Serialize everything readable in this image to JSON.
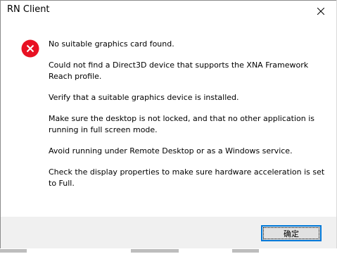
{
  "window": {
    "title": "RN Client",
    "close_icon": "close-icon"
  },
  "message": {
    "icon": "error-icon",
    "icon_color": "#e81123",
    "lines": [
      "No suitable graphics card found.",
      "Could not find a Direct3D device that supports the XNA Framework Reach profile.",
      "Verify that a suitable graphics device is installed.",
      "Make sure the desktop is not locked, and that no other application is running in full screen mode.",
      "Avoid running under Remote Desktop or as a Windows service.",
      "Check the display properties to make sure hardware acceleration is set to Full."
    ]
  },
  "footer": {
    "ok_label": "确定",
    "accent_color": "#0078d7"
  }
}
